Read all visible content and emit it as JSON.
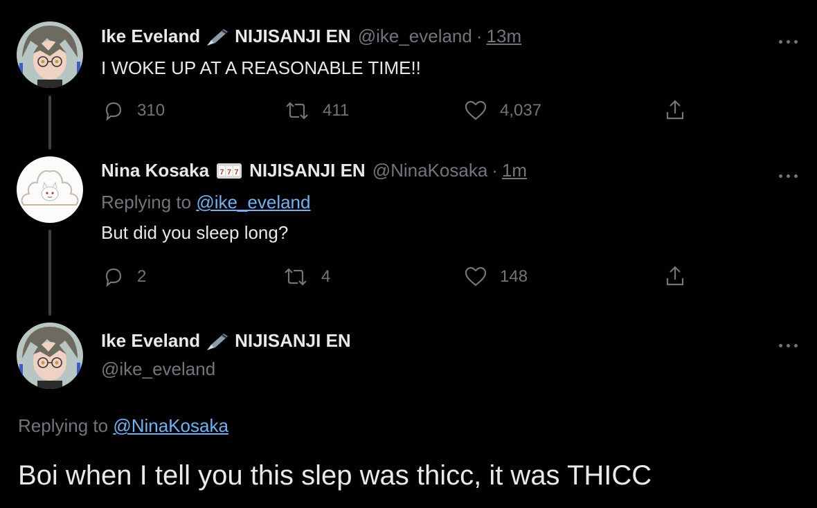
{
  "colors": {
    "background": "#000000",
    "text": "#e7e9ea",
    "muted": "#71767b",
    "link": "#6cb4f5"
  },
  "tweets": [
    {
      "author_name": "Ike Eveland",
      "author_affiliation": "NIJISANJI EN",
      "handle": "@ike_eveland",
      "separator": "·",
      "time": "13m",
      "text": "I WOKE UP AT A REASONABLE TIME!!",
      "stats": {
        "replies": "310",
        "retweets": "411",
        "likes": "4,037"
      },
      "name_emoji_icon": "fountain-pen-icon"
    },
    {
      "author_name": "Nina Kosaka",
      "author_affiliation": "NIJISANJI EN",
      "handle": "@NinaKosaka",
      "separator": "·",
      "time": "1m",
      "replying_prefix": "Replying to",
      "replying_to": "@ike_eveland",
      "text": "But did you sleep long?",
      "stats": {
        "replies": "2",
        "retweets": "4",
        "likes": "148"
      },
      "name_emoji_icon": "slot-machine-icon"
    }
  ],
  "focused": {
    "author_name": "Ike Eveland",
    "author_affiliation": "NIJISANJI EN",
    "handle": "@ike_eveland",
    "replying_prefix": "Replying to",
    "replying_to": "@NinaKosaka",
    "text": "Boi when I tell you this slep was thicc, it was THICC",
    "name_emoji_icon": "fountain-pen-icon"
  }
}
